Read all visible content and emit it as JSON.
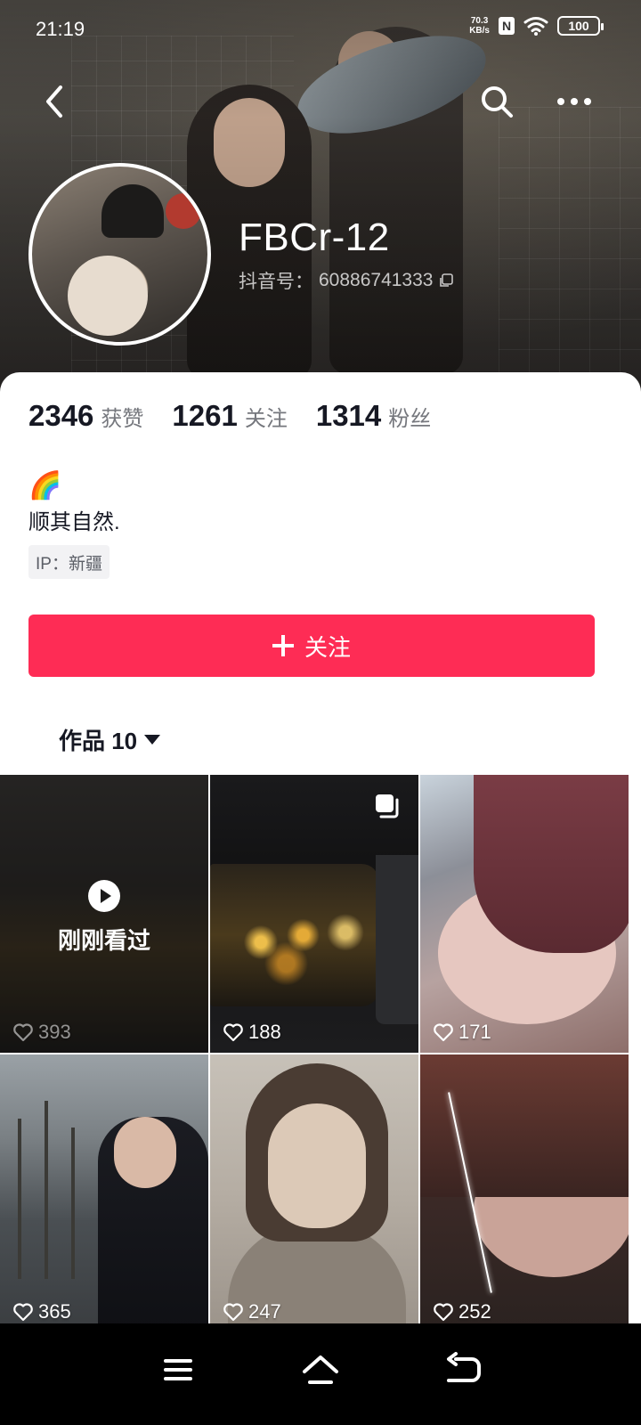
{
  "status_bar": {
    "time": "21:19",
    "net_speed_value": "70.3",
    "net_speed_unit": "KB/s",
    "nfc": "N",
    "battery": "100"
  },
  "profile": {
    "username": "FBCr-12",
    "douyin_id_label": "抖音号：",
    "douyin_id": "60886741333",
    "stats": [
      {
        "value": "2346",
        "label": "获赞"
      },
      {
        "value": "1261",
        "label": "关注"
      },
      {
        "value": "1314",
        "label": "粉丝"
      }
    ],
    "emoji": "🌈",
    "bio": "顺其自然.",
    "ip": "IP：新疆",
    "follow_label": "关注"
  },
  "tabs": {
    "works_label": "作品 10"
  },
  "grid": {
    "watched_label": "刚刚看过",
    "items": [
      {
        "likes": "393"
      },
      {
        "likes": "188"
      },
      {
        "likes": "171"
      },
      {
        "likes": "365"
      },
      {
        "likes": "247"
      },
      {
        "likes": "252"
      }
    ]
  },
  "icons": {
    "back": "chevron-left-icon",
    "search": "search-icon",
    "more": "more-icon",
    "copy": "copy-icon",
    "heart": "heart-outline-icon",
    "play": "play-icon",
    "multi": "multi-image-icon",
    "menu": "menu-icon",
    "home": "home-icon",
    "back_nav": "back-arrow-icon"
  },
  "colors": {
    "accent": "#fe2c55",
    "text_primary": "#161823",
    "text_secondary": "#75777d"
  }
}
